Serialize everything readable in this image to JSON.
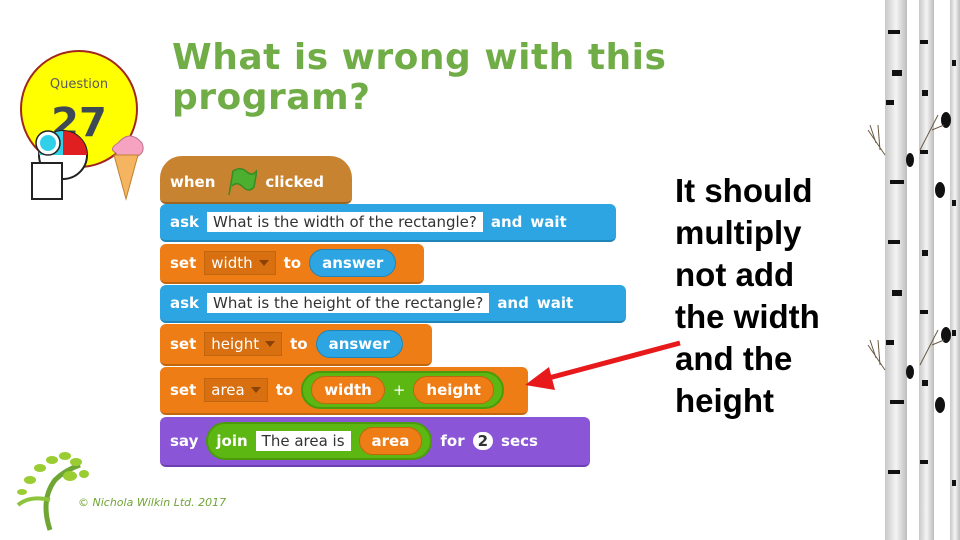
{
  "question": {
    "label": "Question",
    "number": "27"
  },
  "title": [
    "What is wrong with this",
    "program?"
  ],
  "answer_lines": [
    "It should",
    "multiply",
    "not add",
    "the width",
    "and the",
    "height"
  ],
  "footer": "© Nichola Wilkin Ltd. 2017",
  "colors": {
    "title": "#70ad47",
    "arrow": "#e8191b",
    "badge": "#ffff00"
  },
  "program": {
    "hat": {
      "when": "when",
      "icon": "green-flag-icon",
      "clicked": "clicked"
    },
    "ask1": {
      "cmd": "ask",
      "text": "What is the width of the rectangle?",
      "and": "and",
      "wait": "wait"
    },
    "set1": {
      "cmd": "set",
      "var": "width",
      "to": "to",
      "value": "answer"
    },
    "ask2": {
      "cmd": "ask",
      "text": "What is the height of the rectangle?",
      "and": "and",
      "wait": "wait"
    },
    "set2": {
      "cmd": "set",
      "var": "height",
      "to": "to",
      "value": "answer"
    },
    "set3": {
      "cmd": "set",
      "var": "area",
      "to": "to",
      "left": "width",
      "op": "+",
      "right": "height"
    },
    "say": {
      "cmd": "say",
      "join": "join",
      "text": "The area is",
      "var": "area",
      "for": "for",
      "secs_value": "2",
      "secs": "secs"
    }
  }
}
